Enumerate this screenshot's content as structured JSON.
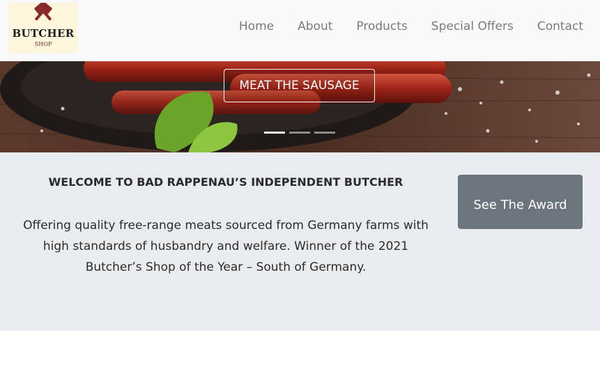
{
  "brand": {
    "logo_text": "BUTCHER",
    "logo_subtext": "SHOP"
  },
  "nav": {
    "links": [
      "Home",
      "About",
      "Products",
      "Special Offers",
      "Contact"
    ]
  },
  "hero": {
    "caption": "MEAT THE SAUSAGE",
    "slide_count": 3,
    "active_slide": 1
  },
  "welcome": {
    "heading": "WELCOME TO BAD RAPPENAU’S INDEPENDENT BUTCHER",
    "body": "Offering quality free-range meats sourced from Germany farms with high standards of husbandry and welfare. Winner of the 2021 Butcher’s Shop of the Year – South of Germany.",
    "button_label": "See The Award"
  },
  "colors": {
    "navbar_bg": "#f8f9fa",
    "nav_link": "#7b7b7b",
    "section_bg": "#e9ecef",
    "button_bg": "#6c757d",
    "logo_accent": "#8a2b2b"
  }
}
